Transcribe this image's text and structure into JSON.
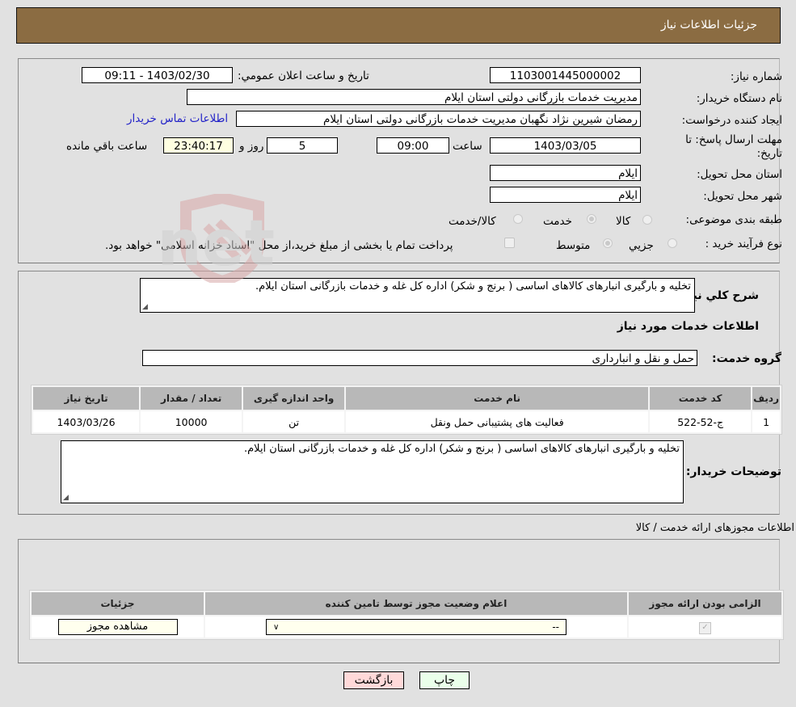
{
  "header": {
    "title": "جزئیات اطلاعات نیاز"
  },
  "details": {
    "need_number_label": "شماره نیاز:",
    "need_number": "1103001445000002",
    "announce_label": "تاریخ و ساعت اعلان عمومي:",
    "announce_value": "1403/02/30 - 09:11",
    "buyer_org_label": "نام دستگاه خريدار:",
    "buyer_org": "مدیریت خدمات بازرگانی دولتی استان ایلام",
    "creator_label": "ايجاد کننده درخواست:",
    "creator": "رمضان شیرین نژاد نگهبان مدیریت خدمات بازرگانی دولتی استان ایلام",
    "contact_link": "اطلاعات تماس خریدار",
    "deadline_label": "مهلت ارسال پاسخ: تا تاریخ:",
    "deadline_date": "1403/03/05",
    "time_label": "ساعت",
    "deadline_time": "09:00",
    "days_value": "5",
    "days_label": "روز و",
    "remaining_time": "23:40:17",
    "remaining_label": "ساعت باقي مانده",
    "province_label": "استان محل تحویل:",
    "province": "ایلام",
    "city_label": "شهر محل تحویل:",
    "city": "ایلام",
    "category_label": "طبقه بندی موضوعی:",
    "category_options": [
      "کالا",
      "خدمت",
      "کالا/خدمت"
    ],
    "category_selected": "خدمت",
    "process_label": "نوع فرآیند خرید :",
    "process_options": [
      "جزيي",
      "متوسط"
    ],
    "process_selected": "متوسط",
    "treasury_note": "پرداخت تمام يا بخشی از مبلغ خريد،از محل \"اسناد خزانه اسلامی\" خواهد بود."
  },
  "summary": {
    "general_desc_label": "شرح کلي نياز:",
    "general_desc": "تخلیه و بارگیری انبارهای کالاهای اساسی ( برنج و شکر) اداره کل غله و خدمات بازرگانی استان ایلام.",
    "services_title": "اطلاعات خدمات مورد نیاز",
    "service_group_label": "گروه خدمت:",
    "service_group": "حمل و نقل و انبارداری",
    "table": {
      "headers": [
        "رديف",
        "کد خدمت",
        "نام خدمت",
        "واحد اندازه گیری",
        "تعداد / مقدار",
        "تاریخ نیاز"
      ],
      "rows": [
        [
          "1",
          "ج-52-522",
          "فعالیت های پشتیبانی حمل ونقل",
          "تن",
          "10000",
          "1403/03/26"
        ]
      ]
    },
    "buyer_notes_label": "توضیحات خریدار:",
    "buyer_notes": "تخلیه و بارگیری انبارهای کالاهای اساسی ( برنج و شکر) اداره کل غله و خدمات بازرگانی استان ایلام."
  },
  "permits": {
    "title": "اطلاعات مجوزهای ارائه خدمت / کالا",
    "headers": [
      "الزامی بودن ارائه مجوز",
      "اعلام وضعیت مجوز توسط تامین کننده",
      "جزئیات"
    ],
    "row": {
      "required_checked": true,
      "status_value": "--",
      "view_button": "مشاهده مجوز"
    }
  },
  "footer": {
    "print_label": "چاپ",
    "back_label": "بازگشت"
  },
  "watermark": {
    "text": "AriaTender.net"
  },
  "colors": {
    "header_bg": "#8b6c42",
    "link": "#2323c8",
    "print_bg": "#eaffea",
    "back_bg": "#ffd9d9"
  }
}
